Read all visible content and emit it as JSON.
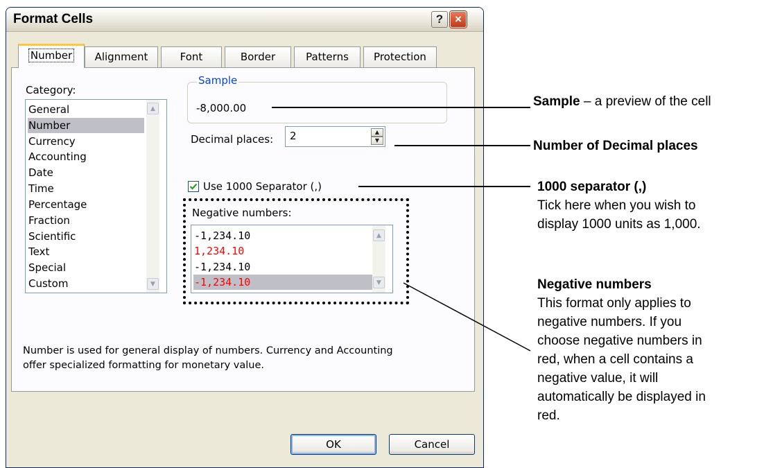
{
  "dialog": {
    "title": "Format Cells",
    "help_icon": "?",
    "close_icon": "×"
  },
  "tabs": [
    {
      "label": "Number"
    },
    {
      "label": "Alignment"
    },
    {
      "label": "Font"
    },
    {
      "label": "Border"
    },
    {
      "label": "Patterns"
    },
    {
      "label": "Protection"
    }
  ],
  "category": {
    "label": "Category:",
    "items": [
      "General",
      "Number",
      "Currency",
      "Accounting",
      "Date",
      "Time",
      "Percentage",
      "Fraction",
      "Scientific",
      "Text",
      "Special",
      "Custom"
    ],
    "selected": "Number"
  },
  "sample": {
    "legend": "Sample",
    "value": "-8,000.00"
  },
  "decimal": {
    "label": "Decimal places:",
    "value": "2"
  },
  "separator": {
    "label": "Use 1000 Separator (,)",
    "checked": true
  },
  "negative": {
    "label": "Negative numbers:",
    "items": [
      {
        "text": "-1,234.10",
        "color": "#000000"
      },
      {
        "text": "1,234.10",
        "color": "#ff0000"
      },
      {
        "text": "-1,234.10",
        "color": "#000000"
      },
      {
        "text": "-1,234.10",
        "color": "#ff0000"
      }
    ],
    "selected_index": 3
  },
  "description": {
    "line1": "Number is used for general display of numbers.  Currency and Accounting",
    "line2": "offer specialized formatting for monetary value."
  },
  "buttons": {
    "ok": "OK",
    "cancel": "Cancel"
  },
  "annotations": {
    "sample_title": "Sample",
    "sample_text": " – a preview of the cell",
    "decimal_title": "Number of Decimal places",
    "separator_title": "1000 separator (,)",
    "separator_text1": "Tick here when you wish to",
    "separator_text2": "display 1000 units as 1,000.",
    "negative_title": "Negative numbers",
    "negative_lines": [
      "This format only applies to",
      "negative numbers. If you",
      "choose negative numbers in",
      "red, when a cell contains a",
      "negative value, it will",
      "automatically be displayed in",
      "red."
    ]
  },
  "colors": {
    "dialog_bg": "#ece9d8",
    "panel_bg": "#fcfcfe",
    "accent_tab": "#ffc83c",
    "legend_blue": "#0046d5",
    "negative_red": "#ff0000",
    "selection_gray": "#bfbfc7"
  }
}
